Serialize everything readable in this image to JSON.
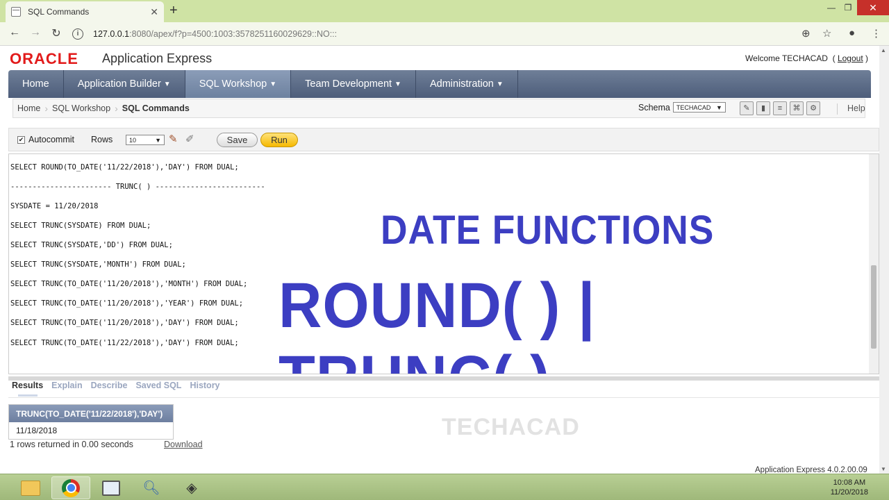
{
  "browser": {
    "tab_title": "SQL Commands",
    "tab_close": "✕",
    "new_tab": "+",
    "url_host": "127.0.0.1",
    "url_rest": ":8080/apex/f?p=4500:1003:3578251160029629::NO:::"
  },
  "header": {
    "logo": "ORACLE",
    "product": "Application Express",
    "welcome": "Welcome TECHACAD",
    "logout": "Logout"
  },
  "nav": {
    "tabs": [
      {
        "label": "Home"
      },
      {
        "label": "Application Builder"
      },
      {
        "label": "SQL Workshop"
      },
      {
        "label": "Team Development"
      },
      {
        "label": "Administration"
      }
    ]
  },
  "breadcrumb": {
    "items": [
      "Home",
      "SQL Workshop",
      "SQL Commands"
    ],
    "schema_label": "Schema",
    "schema_value": "TECHACAD",
    "help": "Help"
  },
  "sql_toolbar": {
    "autocommit": "Autocommit",
    "rows_label": "Rows",
    "rows_value": "10",
    "save": "Save",
    "run": "Run"
  },
  "editor": {
    "lines": [
      "SELECT ROUND(TO_DATE('11/22/2018'),'DAY') FROM DUAL;",
      "----------------------- TRUNC( ) -------------------------",
      "SYSDATE = 11/20/2018",
      "SELECT TRUNC(SYSDATE) FROM DUAL;",
      "SELECT TRUNC(SYSDATE,'DD') FROM DUAL;",
      "SELECT TRUNC(SYSDATE,'MONTH') FROM DUAL;",
      "SELECT TRUNC(TO_DATE('11/20/2018'),'MONTH') FROM DUAL;",
      "SELECT TRUNC(TO_DATE('11/20/2018'),'YEAR') FROM DUAL;",
      "SELECT TRUNC(TO_DATE('11/20/2018'),'DAY') FROM DUAL;",
      "SELECT TRUNC(TO_DATE('11/22/2018'),'DAY') FROM DUAL;"
    ],
    "overlay_title": "DATE FUNCTIONS",
    "overlay_subtitle": "ROUND( ) | TRUNC( )"
  },
  "results": {
    "tabs": [
      "Results",
      "Explain",
      "Describe",
      "Saved SQL",
      "History"
    ],
    "column_header": "TRUNC(TO_DATE('11/22/2018'),'DAY')",
    "value": "11/18/2018",
    "rows_returned": "1 rows returned in 0.00 seconds",
    "download": "Download",
    "watermark": "TECHACAD",
    "version": "Application Express 4.0.2.00.09"
  },
  "taskbar": {
    "time": "10:08 AM",
    "date": "11/20/2018"
  }
}
